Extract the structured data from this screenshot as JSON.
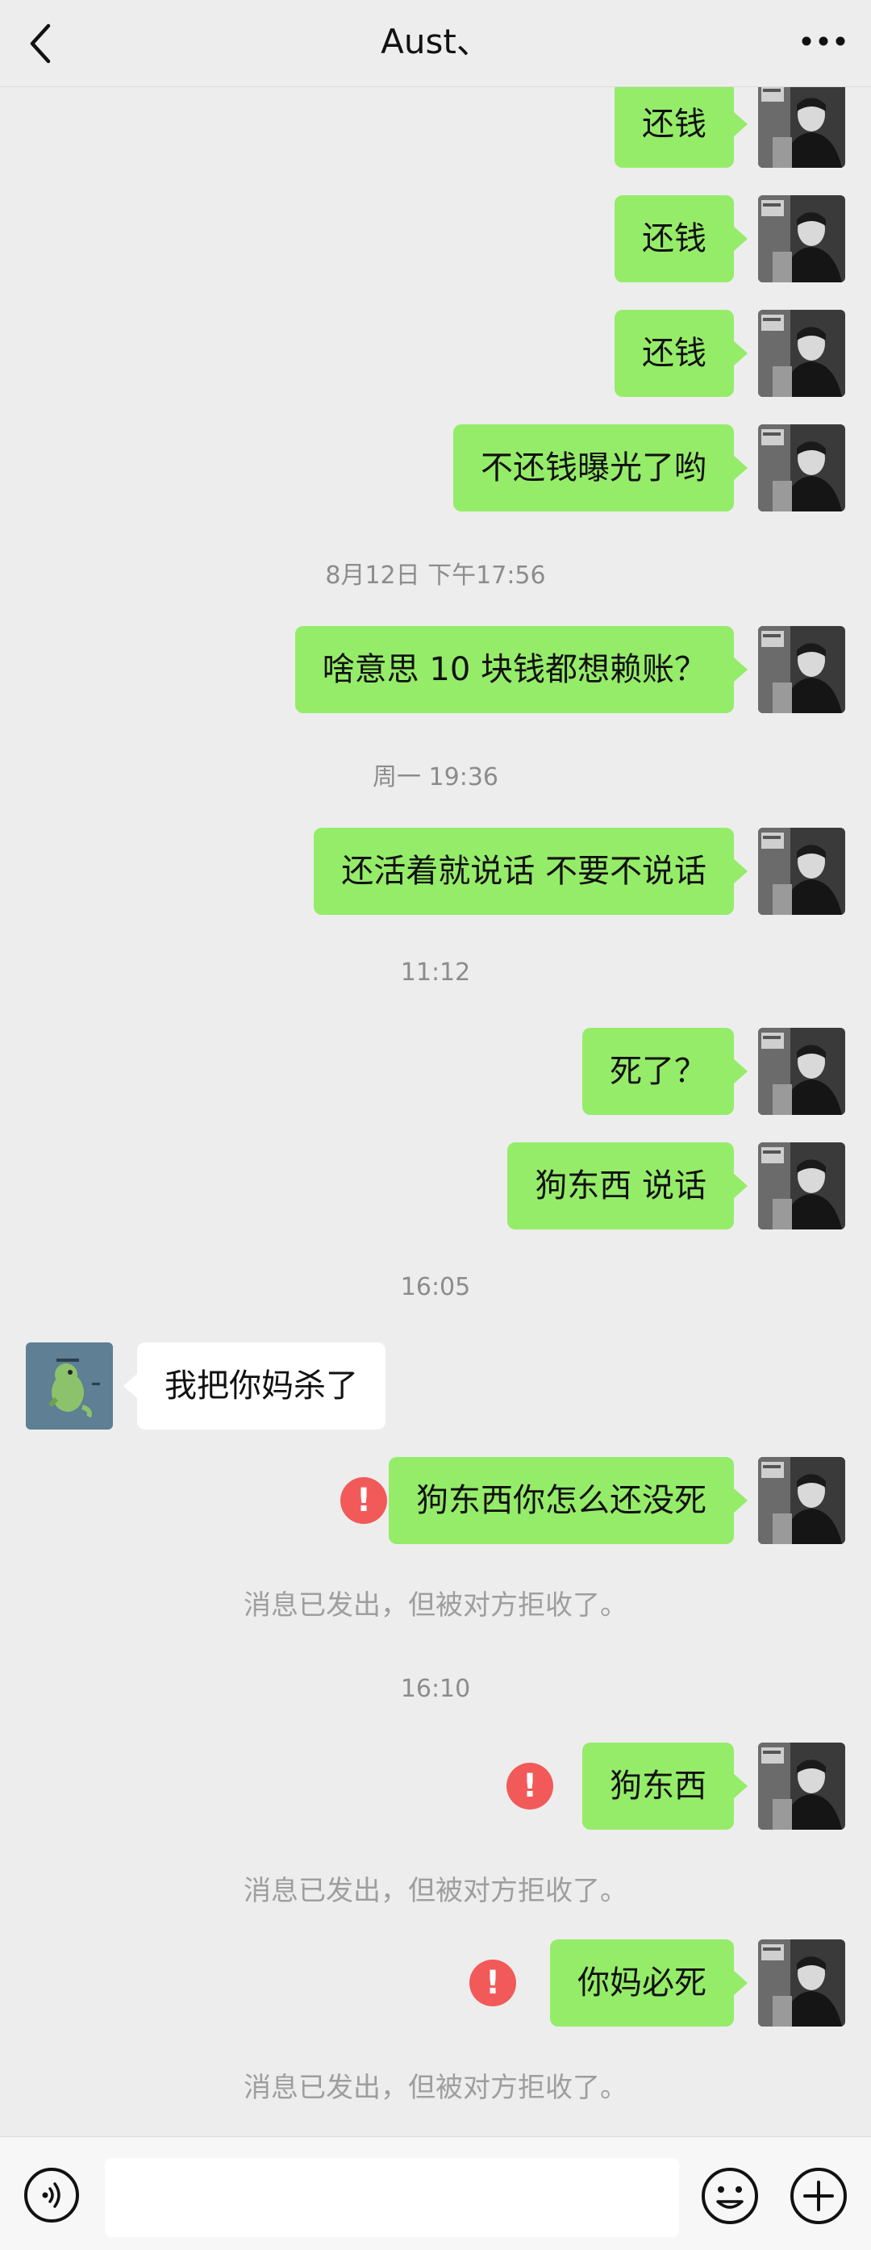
{
  "header": {
    "title": "Aust、"
  },
  "icons": {
    "back": "chevron-left-icon",
    "more": "more-horizontal-icon",
    "voice": "voice-icon",
    "emoji": "emoji-icon",
    "plus": "plus-icon",
    "error": "error-icon"
  },
  "colors": {
    "sent_bubble": "#95EC69",
    "received_bubble": "#FFFFFF",
    "error": "#F25A5A",
    "background": "#EDEDED"
  },
  "messages": {
    "m1": "还钱",
    "m2": "还钱",
    "m3": "还钱",
    "m4": "不还钱曝光了哟",
    "t1": "8月12日 下午17:56",
    "m5": "啥意思  10 块钱都想赖账？",
    "t2": "周一 19:36",
    "m6": "还活着就说话 不要不说话",
    "t3": "11:12",
    "m7": "死了？",
    "m8": "狗东西  说话",
    "t4": "16:05",
    "r1": "我把你妈杀了",
    "m9": "狗东西你怎么还没死",
    "s1": "消息已发出，但被对方拒收了。",
    "t5": "16:10",
    "m10": "狗东西",
    "s2": "消息已发出，但被对方拒收了。",
    "m11": "你妈必死",
    "s3": "消息已发出，但被对方拒收了。",
    "error_mark": "!"
  },
  "footer": {
    "input_value": ""
  }
}
